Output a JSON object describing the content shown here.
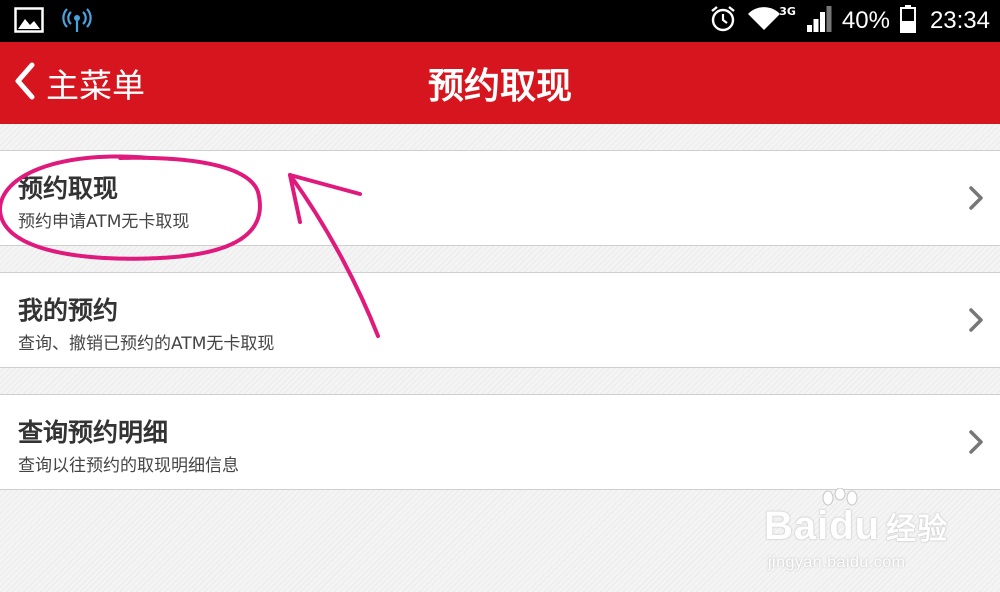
{
  "status_bar": {
    "battery_percent": "40%",
    "time": "23:34",
    "network": "3G"
  },
  "header": {
    "back_label": "主菜单",
    "title": "预约取现"
  },
  "menu": {
    "items": [
      {
        "title": "预约取现",
        "subtitle": "预约申请ATM无卡取现"
      },
      {
        "title": "我的预约",
        "subtitle": "查询、撤销已预约的ATM无卡取现"
      },
      {
        "title": "查询预约明细",
        "subtitle": "查询以往预约的取现明细信息"
      }
    ]
  },
  "watermark": {
    "logo_latin": "Baidu",
    "logo_cn": "经验",
    "url": "jingyan.baidu.com"
  },
  "colors": {
    "header_bg": "#d7151e",
    "annotation": "#e0197d"
  },
  "icons": [
    "gallery-icon",
    "hotspot-icon",
    "alarm-icon",
    "wifi-icon",
    "signal-icon",
    "battery-icon",
    "back-chevron-icon",
    "chevron-right-icon"
  ]
}
